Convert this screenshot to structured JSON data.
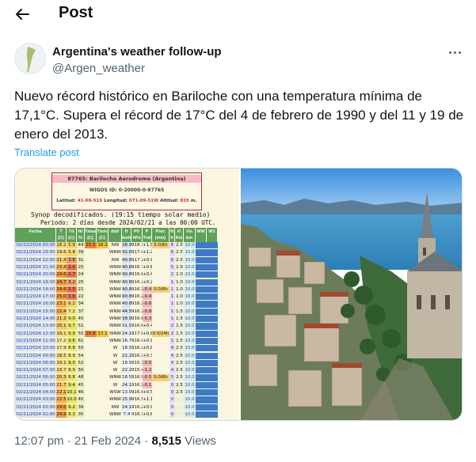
{
  "header": {
    "title": "Post",
    "back_icon": "arrow-left-icon"
  },
  "author": {
    "name": "Argentina's weather follow-up",
    "handle": "@Argen_weather",
    "more_icon": "more-options-icon"
  },
  "tweet": {
    "text": "Nuevo récord histórico en Bariloche con una temperatura mínima de 17,1°C. Supera el récord de 17°C del 4 de febrero de 1990 y del 11 y 19 de enero del 2013.",
    "translate_label": "Translate post"
  },
  "media": {
    "station_title": "87765:  Bariloche Aerodrome (Argentina)",
    "wigos": "WIGOS ID: 0-20000-0-87765",
    "lat_label": "Latitud:",
    "lat": "41-08-51S",
    "lon_label": "Longitud:",
    "lon": "071-09-51W",
    "alt_label": "Altitud:",
    "alt": "835",
    "alt_unit": "m.",
    "synop_line1": "Synop decodificados. (19:15 tiempo solar medio)",
    "synop_line2": "Periodo: 2 días desde  2024/02/21 a las  00:00 UTC.",
    "columns": [
      "Fecha",
      "T (C)",
      "Td (C)",
      "Hr %",
      "Tmax (C)",
      "Tmin (C)",
      "ddd",
      "ff kmh",
      "P0 hPa",
      "P Tnd",
      "Prec (mm)",
      "N h",
      "H Km",
      "Vis km",
      "WW",
      "W1"
    ],
    "rows": [
      {
        "fecha": "02/22/2024 00:00",
        "t": "18.2",
        "td": "5.9",
        "hr": "44",
        "tmax": "25.5",
        "tmin": "18.2",
        "ddd": "NW",
        "ff": "38.9",
        "p0": "918.1",
        "tnd": "+1.5",
        "prec": "0.0/6h",
        "n": "6",
        "h": "2.5",
        "vis": "10.0"
      },
      {
        "fecha": "02/21/2024 23:00",
        "t": "19.6",
        "td": "5.4",
        "hr": "39",
        "tmax": "",
        "tmin": "",
        "ddd": "WNW",
        "ff": "42.6",
        "p0": "917.4",
        "tnd": "+1.2",
        "prec": "",
        "n": "6",
        "h": "2.5",
        "vis": "10.0"
      },
      {
        "fecha": "02/21/2024 22:00",
        "t": "21.4",
        "td": "3.8",
        "hr": "31",
        "tmax": "",
        "tmin": "",
        "ddd": "NW",
        "ff": "40.8",
        "p0": "917.2",
        "tnd": "+0.9",
        "prec": "",
        "n": "6",
        "h": "2.5",
        "vis": "10.0"
      },
      {
        "fecha": "02/21/2024 21:00",
        "t": "23.4",
        "td": "2.0",
        "hr": "25",
        "tmax": "",
        "tmin": "",
        "ddd": "WNW",
        "ff": "40.8",
        "p0": "916.7",
        "tnd": "+0.6",
        "prec": "",
        "n": "5",
        "h": "1.0",
        "vis": "10.0"
      },
      {
        "fecha": "02/21/2024 20:00",
        "t": "24.6",
        "td": "2.7",
        "hr": "24",
        "tmax": "",
        "tmin": "",
        "ddd": "WNW",
        "ff": "40.8",
        "p0": "916.6",
        "tnd": "+0.4",
        "prec": "",
        "n": "1",
        "h": "1.0",
        "vis": "10.0"
      },
      {
        "fecha": "02/21/2024 19:00",
        "t": "24.7",
        "td": "3.2",
        "hr": "25",
        "tmax": "",
        "tmin": "",
        "ddd": "WNW",
        "ff": "40.8",
        "p0": "916.2",
        "tnd": "+0.2",
        "prec": "",
        "n": "1",
        "h": "1.0",
        "vis": "10.0"
      },
      {
        "fecha": "02/21/2024 18:00",
        "t": "24.6",
        "td": "1.0",
        "hr": "21",
        "tmax": "",
        "tmin": "",
        "ddd": "WNW",
        "ff": "40.8",
        "p0": "916.2",
        "tnd": "-0.4",
        "prec": "0.0/6h",
        "n": "1",
        "h": "1.0",
        "vis": "10.0"
      },
      {
        "fecha": "02/21/2024 17:00",
        "t": "25.0",
        "td": "1.6",
        "hr": "22",
        "tmax": "",
        "tmin": "",
        "ddd": "WNW",
        "ff": "40.8",
        "p0": "916.2",
        "tnd": "-0.4",
        "prec": "",
        "n": "1",
        "h": "1.0",
        "vis": "10.0"
      },
      {
        "fecha": "02/21/2024 16:00",
        "t": "23.1",
        "td": "6.2",
        "hr": "34",
        "tmax": "",
        "tmin": "",
        "ddd": "WNW",
        "ff": "40.8",
        "p0": "916.2",
        "tnd": "-0.6",
        "prec": "",
        "n": "1",
        "h": "1.0",
        "vis": "10.0"
      },
      {
        "fecha": "02/21/2024 15:00",
        "t": "22.4",
        "td": "7.2",
        "hr": "37",
        "tmax": "",
        "tmin": "",
        "ddd": "WNW",
        "ff": "44.5",
        "p0": "916.2",
        "tnd": "-0.8",
        "prec": "",
        "n": "1",
        "h": "1.5",
        "vis": "10.0"
      },
      {
        "fecha": "02/21/2024 14:00",
        "t": "21.3",
        "td": "9.0",
        "hr": "45",
        "tmax": "",
        "tmin": "",
        "ddd": "WNW",
        "ff": "38.9",
        "p0": "916.6",
        "tnd": "-0.3",
        "prec": "",
        "n": "1",
        "h": "1.5",
        "vis": "10.0"
      },
      {
        "fecha": "02/21/2024 13:00",
        "t": "20.1",
        "td": "9.7",
        "hr": "51",
        "tmax": "",
        "tmin": "",
        "ddd": "WNW",
        "ff": "31.5",
        "p0": "916.6",
        "tnd": "+0.4",
        "prec": "",
        "n": "2",
        "h": "1.5",
        "vis": "10.0"
      },
      {
        "fecha": "02/21/2024 12:00",
        "t": "19.1",
        "td": "9.9",
        "hr": "55",
        "tmax": "25.8",
        "tmin": "17.1",
        "ddd": "WNW",
        "ff": "24.1",
        "p0": "917.0",
        "tnd": "+0.8",
        "prec": "0.0/24h",
        "n": "2",
        "h": "1.5",
        "vis": "10.0"
      },
      {
        "fecha": "02/21/2024 11:00",
        "t": "17.2",
        "td": "9.6",
        "hr": "61",
        "tmax": "",
        "tmin": "",
        "ddd": "WNW",
        "ff": "16.7",
        "p0": "916.9",
        "tnd": "+0.9",
        "prec": "",
        "n": "1",
        "h": "1.5",
        "vis": "10.0"
      },
      {
        "fecha": "02/21/2024 10:00",
        "t": "17.9",
        "td": "8.8",
        "hr": "55",
        "tmax": "",
        "tmin": "",
        "ddd": "W",
        "ff": "18.5",
        "p0": "916.2",
        "tnd": "+0.8",
        "prec": "",
        "n": "4",
        "h": "2.5",
        "vis": "10.0"
      },
      {
        "fecha": "02/21/2024 09:00",
        "t": "18.5",
        "td": "8.9",
        "hr": "54",
        "tmax": "",
        "tmin": "",
        "ddd": "W",
        "ff": "22.2",
        "p0": "916.2",
        "tnd": "+0.3",
        "prec": "",
        "n": "4",
        "h": "2.5",
        "vis": "10.0"
      },
      {
        "fecha": "02/21/2024 08:00",
        "t": "19.1",
        "td": "9.0",
        "hr": "52",
        "tmax": "",
        "tmin": "",
        "ddd": "W",
        "ff": "18.5",
        "p0": "915.7",
        "tnd": "-0.5",
        "prec": "",
        "n": "4",
        "h": "2.5",
        "vis": "10.0"
      },
      {
        "fecha": "02/21/2024 07:00",
        "t": "19.7",
        "td": "8.9",
        "hr": "50",
        "tmax": "",
        "tmin": "",
        "ddd": "W",
        "ff": "22.2",
        "p0": "915.4",
        "tnd": "-1.2",
        "prec": "",
        "n": "4",
        "h": "2.5",
        "vis": "10.0"
      },
      {
        "fecha": "02/21/2024 06:00",
        "t": "20.3",
        "td": "8.8",
        "hr": "48",
        "tmax": "",
        "tmin": "",
        "ddd": "WNW",
        "ff": "18.5",
        "p0": "916.0",
        "tnd": "-0.5",
        "prec": "0.0/6h",
        "n": "5",
        "h": "2.5",
        "vis": "10.0"
      },
      {
        "fecha": "02/21/2024 05:00",
        "t": "21.7",
        "td": "9.4",
        "hr": "45",
        "tmax": "",
        "tmin": "",
        "ddd": "W",
        "ff": "24.1",
        "p0": "916.2",
        "tnd": "-0.1",
        "prec": "",
        "n": "0",
        "h": "2.5",
        "vis": "10.0"
      },
      {
        "fecha": "02/21/2024 04:00",
        "t": "22.1",
        "td": "10.1",
        "hr": "46",
        "tmax": "",
        "tmin": "",
        "ddd": "WSW",
        "ff": "13.0",
        "p0": "916.6",
        "tnd": "+0.5",
        "prec": "",
        "n": "0",
        "h": "2.5",
        "vis": "10.0"
      },
      {
        "fecha": "02/21/2024 03:00",
        "t": "22.5",
        "td": "10.0",
        "hr": "45",
        "tmax": "",
        "tmin": "",
        "ddd": "WNW",
        "ff": "25.9",
        "p0": "916.5",
        "tnd": "+1.1",
        "prec": "",
        "n": "0",
        "h": "",
        "vis": "10.0"
      },
      {
        "fecha": "02/21/2024 02:00",
        "t": "24.0",
        "td": "9.2",
        "hr": "39",
        "tmax": "",
        "tmin": "",
        "ddd": "NW",
        "ff": "24.1",
        "p0": "916.2",
        "tnd": "+0.9",
        "prec": "",
        "n": "0",
        "h": "",
        "vis": "10.0"
      },
      {
        "fecha": "02/21/2024 01:00",
        "t": "24.9",
        "td": "8.3",
        "hr": "35",
        "tmax": "",
        "tmin": "",
        "ddd": "WNW",
        "ff": "7.4",
        "p0": "916.1",
        "tnd": "+0.8",
        "prec": "",
        "n": "0",
        "h": "",
        "vis": "10.0"
      }
    ]
  },
  "footer": {
    "time": "12:07 pm · 21 Feb 2024 · ",
    "views_count": "8,515",
    "views_label": " Views"
  },
  "colors": {
    "link": "#1d9bf0",
    "secondary_text": "#536471",
    "table_header": "#5fa05a"
  }
}
